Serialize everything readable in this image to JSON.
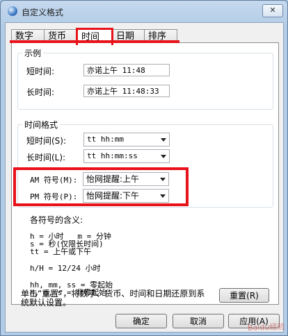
{
  "window": {
    "title": "自定义格式",
    "close_label": "✕"
  },
  "tabs": [
    {
      "label": "数字",
      "active": false
    },
    {
      "label": "货币",
      "active": false
    },
    {
      "label": "时间",
      "active": true
    },
    {
      "label": "日期",
      "active": false
    },
    {
      "label": "排序",
      "active": false
    }
  ],
  "example": {
    "title": "示例",
    "short_label": "短时间:",
    "short_value": "亦诺上午 11:48",
    "long_label": "长时间:",
    "long_value": "亦诺上午 11:48:33"
  },
  "formats": {
    "title": "时间格式",
    "short_label": "短时间(S):",
    "short_value": "tt hh:mm",
    "long_label": "长时间(L):",
    "long_value": "tt hh:mm:ss",
    "am_label": "AM 符号(M):",
    "am_value": "怡网提醒:上午",
    "pm_label": "PM 符号(P):",
    "pm_value": "怡网提醒:下午"
  },
  "legend": {
    "title": "各符号的含义:",
    "line1": "h = 小时   m = 分钟",
    "line2": "s = 秒(仅限长时间)",
    "line3": "tt = 上午或下午",
    "line4": "h/H = 12/24 小时",
    "line5": "hh, mm, ss = 零起始",
    "line6": "h, m, s = 非零起始"
  },
  "reset": {
    "text1": "单击“重置”，将数字、货币、时间和日期还原到系",
    "text2": "统默认设置。",
    "button": "重置(R)"
  },
  "footer": {
    "ok": "确定",
    "cancel": "取消",
    "apply": "应用(A)"
  },
  "watermark": "Baidu经验"
}
